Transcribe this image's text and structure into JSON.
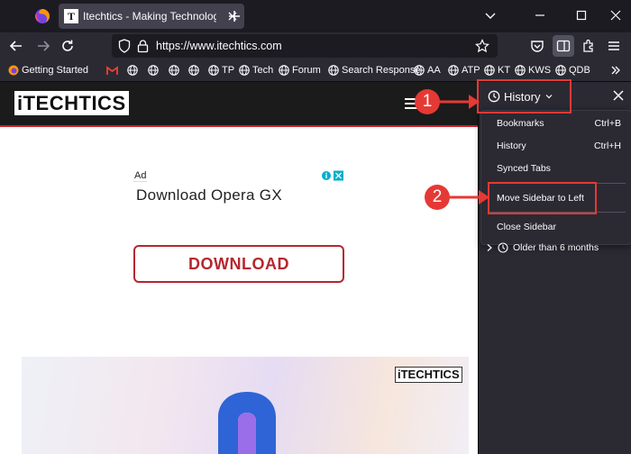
{
  "browser": {
    "tab": {
      "title": "Itechtics - Making Technology Work For You",
      "favicon_letter": "T"
    },
    "url": "https://www.itechtics.com",
    "bookmarks": [
      {
        "label": "Getting Started",
        "icon": "firefox-icon"
      },
      {
        "label": "",
        "icon": "gmail-icon"
      },
      {
        "label": "",
        "icon": "globe-icon"
      },
      {
        "label": "",
        "icon": "globe-icon"
      },
      {
        "label": "",
        "icon": "globe-icon"
      },
      {
        "label": "",
        "icon": "globe-icon"
      },
      {
        "label": "TP",
        "icon": "globe-icon"
      },
      {
        "label": "Tech",
        "icon": "globe-icon"
      },
      {
        "label": "Forum",
        "icon": "globe-icon"
      },
      {
        "label": "Search Response",
        "icon": "globe-icon"
      },
      {
        "label": "AA",
        "icon": "globe-icon"
      },
      {
        "label": "ATP",
        "icon": "globe-icon"
      },
      {
        "label": "KT",
        "icon": "globe-icon"
      },
      {
        "label": "KWS",
        "icon": "globe-icon"
      },
      {
        "label": "QDB",
        "icon": "globe-icon"
      }
    ]
  },
  "page": {
    "logo": "iTECHTICS",
    "ad_label": "Ad",
    "ad_title": "Download Opera GX",
    "download_button": "DOWNLOAD",
    "banner_logo": "iTECHTICS"
  },
  "sidebar": {
    "switcher_label": "History",
    "menu": [
      {
        "label": "Bookmarks",
        "shortcut": "Ctrl+B"
      },
      {
        "label": "History",
        "shortcut": "Ctrl+H"
      },
      {
        "label": "Synced Tabs",
        "shortcut": ""
      },
      {
        "label": "Move Sidebar to Left",
        "shortcut": ""
      },
      {
        "label": "Close Sidebar",
        "shortcut": ""
      }
    ],
    "history_group": "Older than 6 months"
  },
  "annotations": {
    "step1": "1",
    "step2": "2"
  },
  "colors": {
    "annotation": "#e53935",
    "accent": "#b5272f"
  }
}
